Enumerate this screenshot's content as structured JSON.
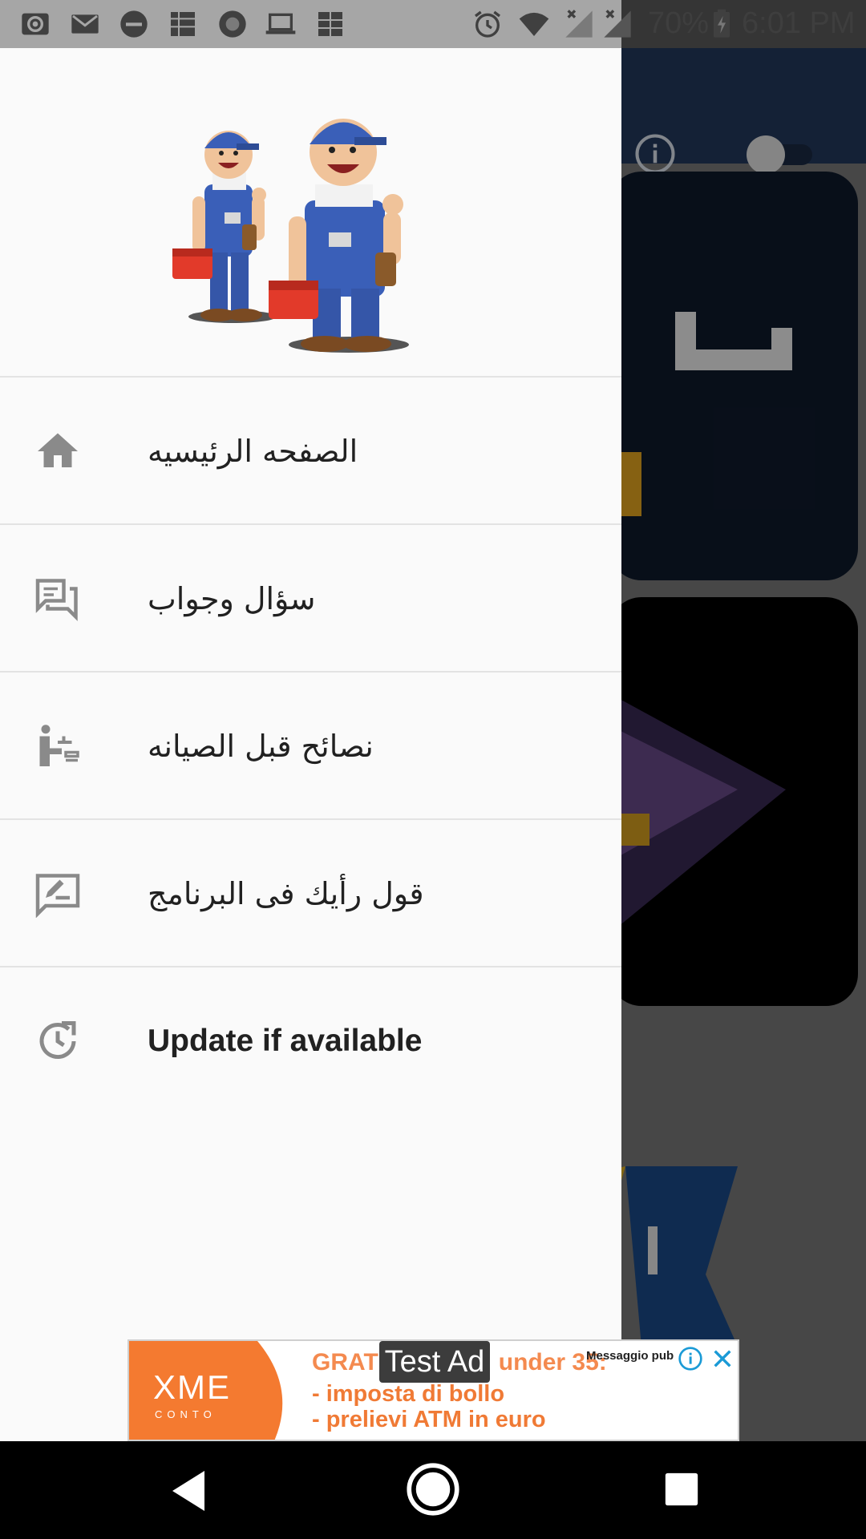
{
  "status_bar": {
    "battery_text": "70%",
    "time": "6:01 PM",
    "left_icons": [
      "cast-icon",
      "mail-icon",
      "dnd-icon",
      "app-icon",
      "record-icon",
      "laptop-icon",
      "app-icon"
    ],
    "right_icons": [
      "alarm-icon",
      "wifi-icon",
      "signal-icon",
      "signal-icon",
      "battery-charging-icon"
    ]
  },
  "drawer": {
    "items": [
      {
        "label": "الصفحه الرئيسيه",
        "icon": "home-icon"
      },
      {
        "label": "سؤال وجواب",
        "icon": "forum-icon"
      },
      {
        "label": "نصائح قبل الصيانه",
        "icon": "service-icon"
      },
      {
        "label": "قول رأيك فى البرنامج",
        "icon": "rate-review-icon"
      },
      {
        "label": "Update if available",
        "icon": "update-icon"
      }
    ]
  },
  "ad": {
    "test_badge": "Test Ad",
    "headline_left": "GRAT",
    "headline_right": "under 35:",
    "line_1": "- imposta di bollo",
    "line_2": "- prelievi ATM in euro",
    "ad_label": "Messaggio pub",
    "brand": "XME",
    "brand_sub": "CONTO"
  },
  "colors": {
    "drawer_bg": "#fafafa",
    "toolbar": "#233a5e",
    "ad_orange": "#f47a30",
    "icon_gray": "#8a8a8a"
  }
}
